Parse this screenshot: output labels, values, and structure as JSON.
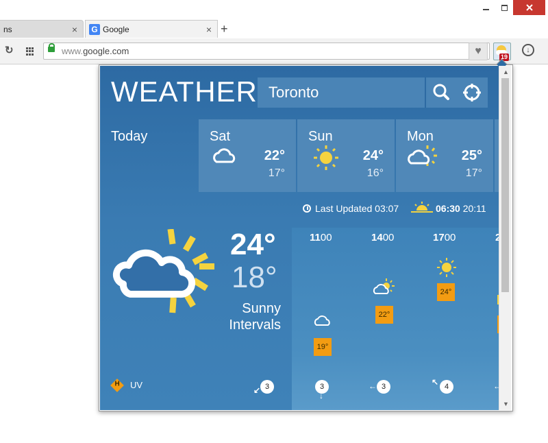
{
  "browser": {
    "tabs": [
      {
        "title": "ns",
        "close": "×"
      },
      {
        "title": "Google",
        "favicon": "G",
        "close": "×"
      }
    ],
    "new_tab": "+",
    "url_scheme": "www.",
    "url_host": "google.com",
    "extension_badge": "19"
  },
  "weather": {
    "brand": "WEATHER",
    "search_city": "Toronto",
    "today_label": "Today",
    "days": [
      {
        "name": "Sat",
        "hi": "22°",
        "lo": "17°",
        "icon": "cloud-icon"
      },
      {
        "name": "Sun",
        "hi": "24°",
        "lo": "16°",
        "icon": "sun-icon"
      },
      {
        "name": "Mon",
        "hi": "25°",
        "lo": "17°",
        "icon": "partly-cloudy-icon"
      }
    ],
    "last_updated": "Last Updated 03:07",
    "sunrise": "06:30",
    "sunset": "20:11",
    "current": {
      "hi": "24°",
      "lo": "18°",
      "condition_line1": "Sunny",
      "condition_line2": "Intervals"
    },
    "hours": [
      {
        "bold": "11",
        "rest": "00",
        "temp": "19°",
        "wind": "3"
      },
      {
        "bold": "14",
        "rest": "00",
        "temp": "22°",
        "wind": "3"
      },
      {
        "bold": "17",
        "rest": "00",
        "temp": "24°",
        "wind": "4"
      },
      {
        "bold": "2",
        "rest": "",
        "temp": "",
        "wind": ""
      }
    ],
    "uv_letter": "H",
    "uv_label": "UV",
    "today_wind": "3",
    "colors": {
      "accent": "#2d6aa3",
      "sun": "#f5d33f",
      "chip": "#f39c12"
    }
  }
}
